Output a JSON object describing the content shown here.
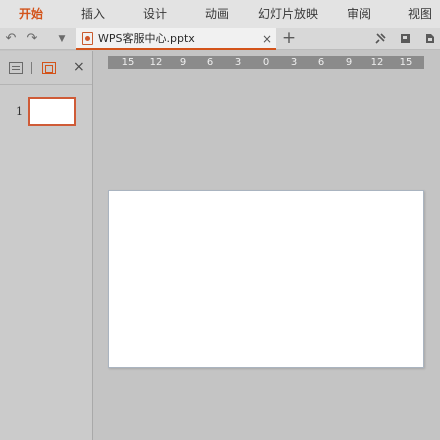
{
  "menu": {
    "tabs": [
      {
        "label": "开始",
        "active": true
      },
      {
        "label": "插入"
      },
      {
        "label": "设计"
      },
      {
        "label": "动画"
      },
      {
        "label": "幻灯片放映"
      },
      {
        "label": "审阅"
      },
      {
        "label": "视图"
      }
    ]
  },
  "toolbar": {
    "undo_icon": "↶",
    "redo_icon": "↷",
    "dropdown_icon": "▼",
    "add_tab": "+",
    "right_icons": [
      "pin-icon",
      "share-icon",
      "cloud-icon"
    ]
  },
  "document_tab": {
    "title": "WPS客服中心.pptx",
    "close": "×"
  },
  "panel": {
    "close": "×",
    "slides": [
      {
        "number": "1"
      }
    ]
  },
  "ruler": {
    "ticks": [
      "15",
      "12",
      "9",
      "6",
      "3",
      "0",
      "3",
      "6",
      "9",
      "12",
      "15"
    ]
  },
  "colors": {
    "accent": "#d3531a",
    "workspace": "#c4c4c4",
    "ruler": "#8b8b8b",
    "slide": "#ffffff"
  }
}
